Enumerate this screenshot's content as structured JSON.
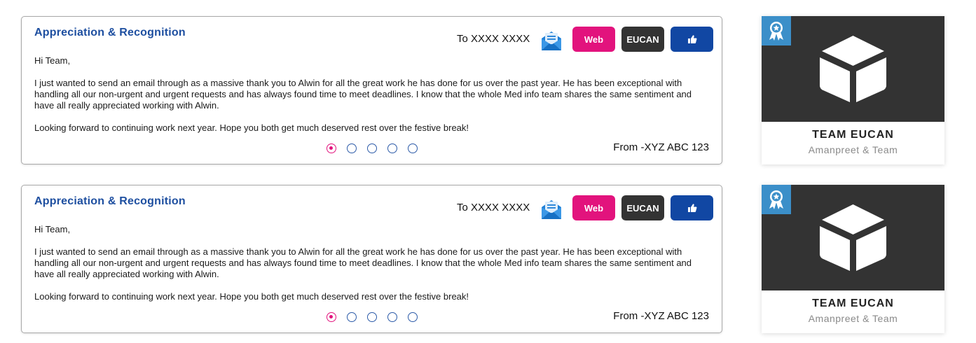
{
  "posts": [
    {
      "title": "Appreciation & Recognition",
      "to": "To XXXX XXXX",
      "mail_icon": "envelope-open-icon",
      "buttons": {
        "web": "Web",
        "region": "EUCAN",
        "like_icon": "thumbs-up-icon"
      },
      "greeting": "Hi Team,",
      "message": "I just wanted to send an email through as a massive thank you to Alwin for all the great work he has done for us over the past year. He has been exceptional with handling all our non-urgent and urgent requests and has always found time to meet deadlines. I know that the whole Med info team shares the same sentiment and have all really appreciated working with Alwin.",
      "closing": "Looking forward to continuing work next year. Hope you both get much deserved rest over the festive break!",
      "from": "From -XYZ ABC 123",
      "pagination": {
        "count": 5,
        "active": 1
      },
      "team": {
        "name": "TEAM EUCAN",
        "members": "Amanpreet & Team",
        "badge_icon": "award-ribbon-icon",
        "image_icon": "cube-icon"
      }
    },
    {
      "title": "Appreciation & Recognition",
      "to": "To XXXX XXXX",
      "mail_icon": "envelope-open-icon",
      "buttons": {
        "web": "Web",
        "region": "EUCAN",
        "like_icon": "thumbs-up-icon"
      },
      "greeting": "Hi Team,",
      "message": "I just wanted to send an email through as a massive thank you to Alwin for all the great work he has done for us over the past year. He has been exceptional with handling all our non-urgent and urgent requests and has always found time to meet deadlines. I know that the whole Med info team shares the same sentiment and have all really appreciated working with Alwin.",
      "closing": "Looking forward to continuing work next year. Hope you both get much deserved rest over the festive break!",
      "from": "From -XYZ ABC 123",
      "pagination": {
        "count": 5,
        "active": 1
      },
      "team": {
        "name": "TEAM EUCAN",
        "members": "Amanpreet & Team",
        "badge_icon": "award-ribbon-icon",
        "image_icon": "cube-icon"
      }
    }
  ],
  "colors": {
    "title": "#1e4fa0",
    "web_button": "#e2137d",
    "region_button": "#333333",
    "like_button": "#1147a3",
    "team_image_bg": "#333333",
    "badge_bg": "#3b8fc9"
  }
}
